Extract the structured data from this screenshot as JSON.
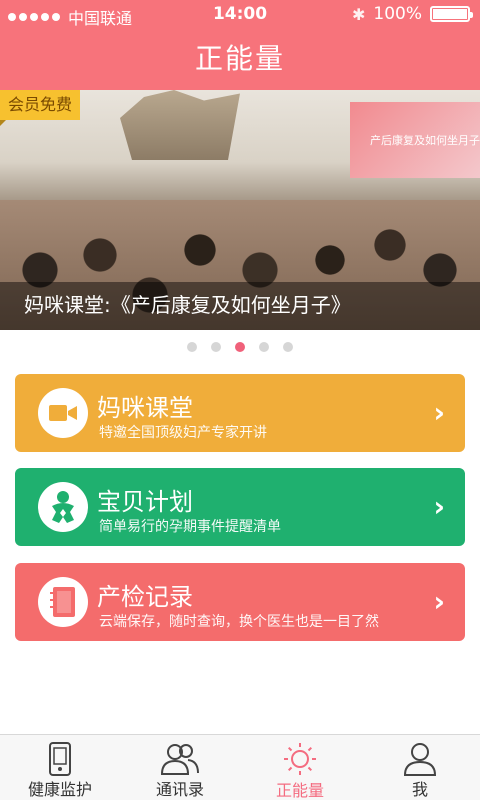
{
  "status": {
    "carrier": "中国联通",
    "time": "14:00",
    "battery": "100%",
    "signal_bars": 5
  },
  "header": {
    "title": "正能量"
  },
  "banner": {
    "badge": "会员免费",
    "caption": "妈咪课堂:《产后康复及如何坐月子》",
    "screen_text": "产后康复及如何坐月子",
    "pages": 5,
    "active_page": 3
  },
  "cards": [
    {
      "title": "妈咪课堂",
      "subtitle": "特邀全国顶级妇产专家开讲",
      "icon": "video-camera-icon",
      "color": "#f0ad3a"
    },
    {
      "title": "宝贝计划",
      "subtitle": "简单易行的孕期事件提醒清单",
      "icon": "baby-icon",
      "color": "#1fb06f"
    },
    {
      "title": "产检记录",
      "subtitle": "云端保存，随时查询，换个医生也是一目了然",
      "icon": "notebook-icon",
      "color": "#f46c6c"
    }
  ],
  "tabs": [
    {
      "label": "健康监护",
      "icon": "phone-device-icon"
    },
    {
      "label": "通讯录",
      "icon": "contacts-icon"
    },
    {
      "label": "正能量",
      "icon": "sun-icon",
      "active": true
    },
    {
      "label": "我",
      "icon": "person-icon"
    }
  ],
  "colors": {
    "primary": "#f7737b",
    "active_tab": "#f46c80",
    "pager_active": "#f0617a"
  }
}
